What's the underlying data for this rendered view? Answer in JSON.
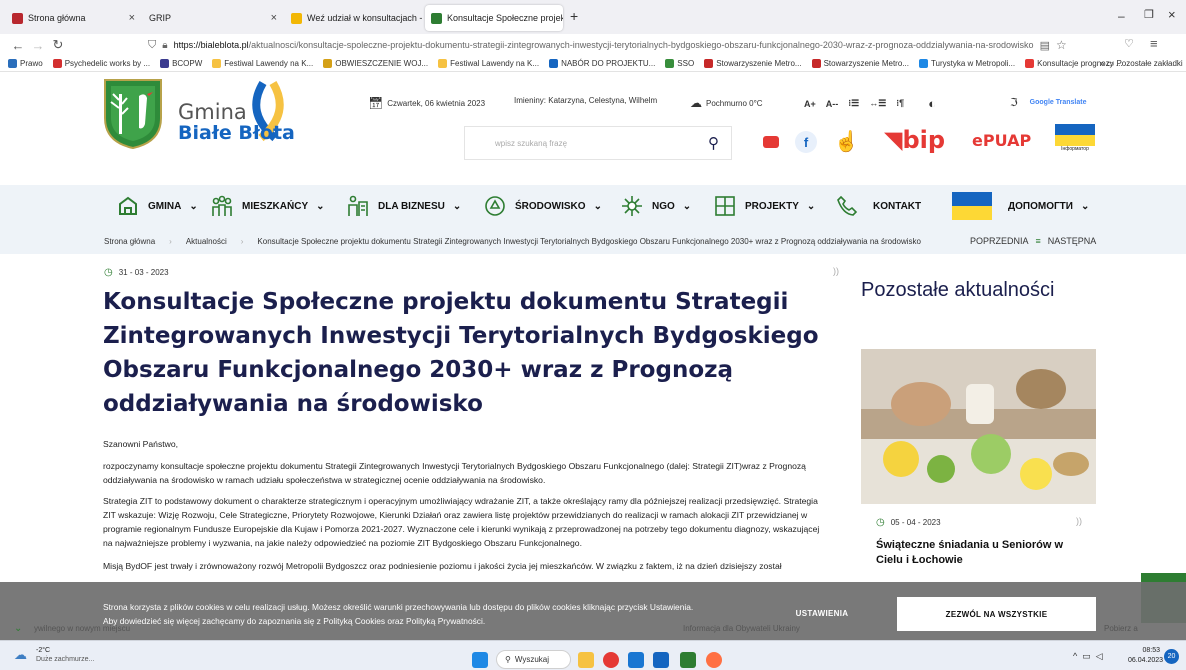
{
  "browser": {
    "tabs": [
      {
        "label": "Strona główna",
        "favicon_color": "#b8272e"
      },
      {
        "label": "GRIP",
        "favicon_color": "#ffffff"
      },
      {
        "label": "Weź udział w konsultacjach - AI ×",
        "favicon_color": "#f2b705"
      },
      {
        "label": "Konsultacje Społeczne projektu",
        "favicon_color": "#2e7d32"
      }
    ],
    "new_tab": "+",
    "url_host": "https://bialeblota.pl",
    "url_path": "/aktualnosci/konsultacje-spoleczne-projektu-dokumentu-strategii-zintegrowanych-inwestycji-terytorialnych-bydgoskiego-obszaru-funkcjonalnego-2030-wraz-z-prognoza-oddzialywania-na-srodowisko.htm",
    "bookmarks": [
      {
        "label": "Prawo",
        "color": "#2a6ebb"
      },
      {
        "label": "Psychedelic works by ...",
        "color": "#d32f2f"
      },
      {
        "label": "BCOPW",
        "color": "#3b3b8f"
      },
      {
        "label": "Festiwal Lawendy na K...",
        "color": "#f6c242"
      },
      {
        "label": "OBWIESZCZENIE WOJ...",
        "color": "#d4a017"
      },
      {
        "label": "Festiwal Lawendy na K...",
        "color": "#f6c242"
      },
      {
        "label": "NABÓR DO PROJEKTU...",
        "color": "#1565c0"
      },
      {
        "label": "SSO",
        "color": "#388e3c"
      },
      {
        "label": "Stowarzyszenie Metro...",
        "color": "#c62828"
      },
      {
        "label": "Stowarzyszenie Metro...",
        "color": "#c62828"
      },
      {
        "label": "Turystyka w Metropoli...",
        "color": "#1e88e5"
      },
      {
        "label": "Konsultacje prognozy ...",
        "color": "#e53935"
      }
    ],
    "bookmarks_other": "Pozostałe zakładki"
  },
  "header": {
    "logo_line1": "Gmina",
    "logo_line2": "Białe Błota",
    "date": "Czwartek, 06 kwietnia 2023",
    "nameday": "Imieniny: Katarzyna, Celestyna, Wilhelm",
    "weather": "Pochmurno 0°C",
    "font_large": "A+",
    "font_small": "A--",
    "google_translate": "Google Translate",
    "search_placeholder": "wpisz szukaną frazę",
    "bip": "bip",
    "epuap": "ePUAP",
    "ukr_info": "Інформатор"
  },
  "menu": [
    {
      "label": "GMINA",
      "icon": "gmina-icon"
    },
    {
      "label": "MIESZKAŃCY",
      "icon": "people-icon"
    },
    {
      "label": "DLA BIZNESU",
      "icon": "business-icon"
    },
    {
      "label": "ŚRODOWISKO",
      "icon": "recycle-icon"
    },
    {
      "label": "NGO",
      "icon": "ngo-icon"
    },
    {
      "label": "PROJEKTY",
      "icon": "puzzle-icon"
    },
    {
      "label": "KONTAKT",
      "icon": "phone-icon"
    },
    {
      "label": "ДОПОМОГТИ",
      "icon": "ukraine-flag-icon"
    }
  ],
  "breadcrumb": {
    "items": [
      "Strona główna",
      "Aktualności",
      "Konsultacje Społeczne projektu dokumentu Strategii Zintegrowanych Inwestycji Terytorialnych Bydgoskiego Obszaru Funkcjonalnego 2030+ wraz z Prognozą oddziaływania na środowisko"
    ],
    "prev": "POPRZEDNIA",
    "next": "NASTĘPNA"
  },
  "article": {
    "date": "31 - 03 - 2023",
    "title": "Konsultacje Społeczne projektu dokumentu Strategii Zintegrowanych Inwestycji Terytorialnych Bydgoskiego Obszaru Funkcjonalnego 2030+ wraz z Prognozą oddziaływania na środowisko",
    "greeting": "Szanowni Państwo,",
    "p1": "rozpoczynamy konsultacje społeczne projektu dokumentu Strategii Zintegrowanych Inwestycji Terytorialnych Bydgoskiego Obszaru Funkcjonalnego (dalej: Strategii ZIT)wraz z Prognozą oddziaływania na środowisko w ramach udziału społeczeństwa w strategicznej ocenie oddziaływania na środowisko.",
    "p2": "Strategia ZIT to podstawowy dokument o charakterze strategicznym i operacyjnym umożliwiający wdrażanie ZIT, a także określający ramy dla późniejszej realizacji przedsięwzięć. Strategia ZIT wskazuje: Wizję Rozwoju, Cele Strategiczne, Priorytety Rozwojowe, Kierunki Działań oraz zawiera listę projektów przewidzianych do realizacji w ramach alokacji ZIT przewidzianej w programie regionalnym Fundusze Europejskie dla Kujaw i Pomorza 2021-2027. Wyznaczone cele i kierunki wynikają z przeprowadzonej na potrzeby tego dokumentu diagnozy, wskazującej na najważniejsze problemy i wyzwania, na jakie należy odpowiedzieć na poziomie ZIT Bydgoskiego Obszaru Funkcjonalnego.",
    "p3": "Misją BydOF jest trwały i zrównoważony rozwój Metropolii Bydgoszcz oraz podniesienie poziomu i jakości życia jej mieszkańców. W związku z faktem, iż na dzień dzisiejszy został"
  },
  "sidebar": {
    "heading": "Pozostałe aktualności",
    "item_date": "05 - 04 - 2023",
    "item_title": "Świąteczne śniadania u Seniorów w Cielu i Łochowie"
  },
  "cookie": {
    "line1": "Strona korzysta z plików cookies w celu realizacji usług. Możesz określić warunki przechowywania lub dostępu do plików cookies kliknając przycisk Ustawienia.",
    "line2": "Aby dowiedzieć się więcej zachęcamy do zapoznania się z Polityką Cookies oraz Polityką Prywatności.",
    "settings": "USTAWIENIA",
    "accept": "ZEZWÓL NA WSZYSTKIE"
  },
  "bottom_strip": {
    "left": "ywilnego w nowym miejscu",
    "middle": "Informacja dla Obywateli Ukrainy",
    "right": "Pobierz a"
  },
  "taskbar": {
    "temp": "-2°C",
    "weather_desc": "Duże zachmurze...",
    "search": "Wyszukaj",
    "time": "08:53",
    "date": "06.04.2023",
    "notif": "20"
  }
}
